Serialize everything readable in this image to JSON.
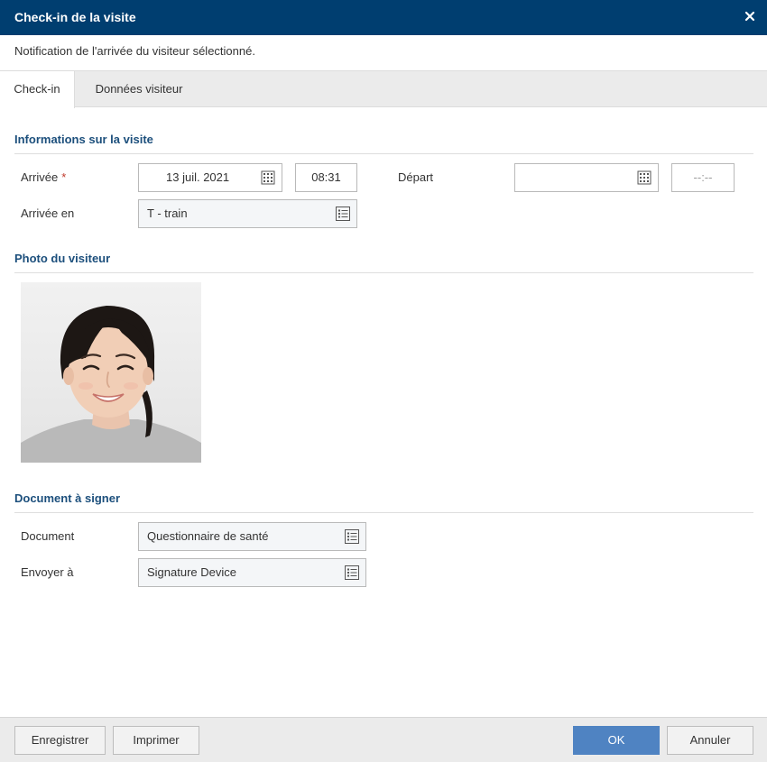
{
  "dialog": {
    "title": "Check-in de la visite",
    "subtitle": "Notification de l'arrivée du visiteur sélectionné."
  },
  "tabs": [
    {
      "label": "Check-in",
      "active": true
    },
    {
      "label": "Données visiteur",
      "active": false
    }
  ],
  "visit_info": {
    "section_title": "Informations sur la visite",
    "arrival_label": "Arrivée",
    "arrival_required_mark": "*",
    "arrival_date": "13 juil. 2021",
    "arrival_time": "08:31",
    "departure_label": "Départ",
    "departure_date": "",
    "departure_time_placeholder": "--:--",
    "arrival_at_label": "Arrivée en",
    "arrival_at_value": "T - train"
  },
  "photo_section": {
    "section_title": "Photo du visiteur"
  },
  "document_section": {
    "section_title": "Document à signer",
    "document_label": "Document",
    "document_value": "Questionnaire de santé",
    "send_to_label": "Envoyer à",
    "send_to_value": "Signature Device"
  },
  "footer": {
    "save_label": "Enregistrer",
    "print_label": "Imprimer",
    "ok_label": "OK",
    "cancel_label": "Annuler"
  },
  "colors": {
    "title_bar": "#003e70",
    "section_title": "#1c4f7c",
    "primary_button": "#4f83c2",
    "required_mark": "#c0392b"
  },
  "icons": {
    "close": "close-icon",
    "calendar": "calendar-icon",
    "list": "list-icon"
  }
}
